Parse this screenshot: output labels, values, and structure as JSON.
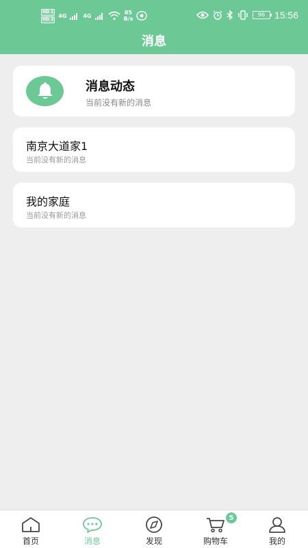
{
  "status_bar": {
    "sim1": "HD 1",
    "sim2": "HD 2",
    "net1": "4G",
    "net2": "4G",
    "speed_value": "85",
    "speed_unit": "B/s",
    "battery": "96",
    "time": "15:56"
  },
  "header": {
    "title": "消息"
  },
  "notice_card": {
    "title": "消息动态",
    "subtitle": "当前没有新的消息",
    "icon": "bell-icon"
  },
  "conversations": [
    {
      "title": "南京大道家1",
      "subtitle": "当前没有新的消息"
    },
    {
      "title": "我的家庭",
      "subtitle": "当前没有新的消息"
    }
  ],
  "tabbar": {
    "items": [
      {
        "label": "首页",
        "icon": "home-icon"
      },
      {
        "label": "消息",
        "icon": "chat-icon",
        "active": true
      },
      {
        "label": "发现",
        "icon": "compass-icon"
      },
      {
        "label": "购物车",
        "icon": "cart-icon",
        "badge": "5"
      },
      {
        "label": "我的",
        "icon": "user-icon"
      }
    ]
  },
  "colors": {
    "accent": "#6cc894",
    "background": "#eeeeee"
  }
}
